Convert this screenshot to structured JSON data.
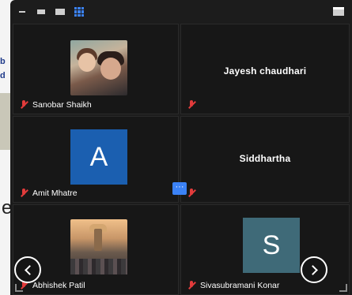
{
  "background": {
    "side_text_1": "b",
    "side_text_2": "d",
    "side_char": "e"
  },
  "toolbar": {
    "icons": [
      "minimize-icon",
      "speaker-view-icon",
      "strip-view-icon",
      "gallery-view-icon",
      "fullscreen-icon"
    ],
    "active_color": "#3b82f6"
  },
  "participants": [
    {
      "name": "Sanobar Shaikh",
      "muted": true,
      "type": "photo"
    },
    {
      "name": "Jayesh chaudhari",
      "muted": true,
      "type": "name-only"
    },
    {
      "name": "Amit Mhatre",
      "muted": true,
      "type": "avatar",
      "initial": "A",
      "color": "#1b5fb0"
    },
    {
      "name": "Siddhartha",
      "muted": true,
      "type": "name-only"
    },
    {
      "name": "Abhishek Patil",
      "muted": true,
      "type": "photo"
    },
    {
      "name": "Sivasubramani Konar",
      "muted": true,
      "type": "avatar",
      "initial": "S",
      "color": "#3f6a78"
    }
  ],
  "controls": {
    "more": "···",
    "prev": "previous-page",
    "next": "next-page"
  }
}
